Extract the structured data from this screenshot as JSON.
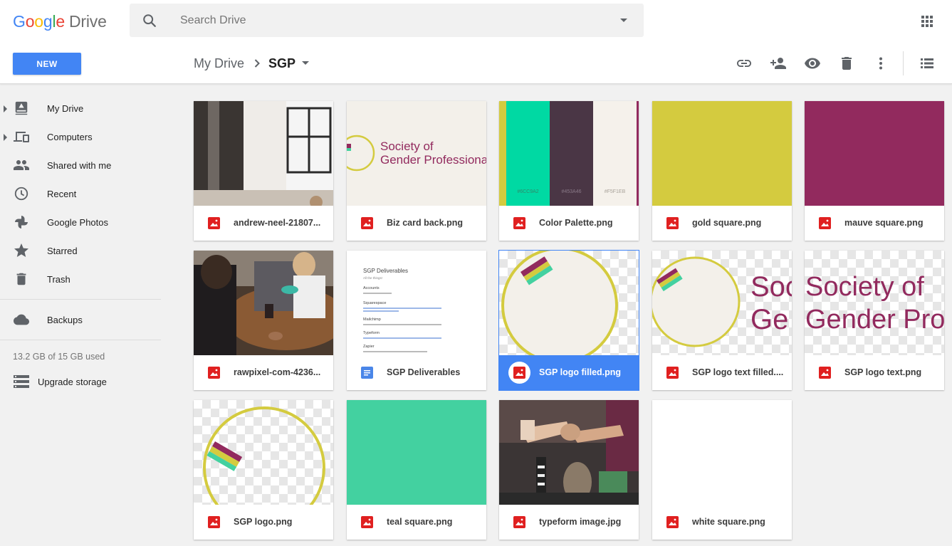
{
  "header": {
    "logo_letters": [
      "G",
      "o",
      "o",
      "g",
      "l",
      "e"
    ],
    "logo_product": "Drive",
    "search_placeholder": "Search Drive"
  },
  "toolbar": {
    "new_label": "NEW",
    "breadcrumb_root": "My Drive",
    "breadcrumb_current": "SGP",
    "actions": [
      "link-icon",
      "add-person-icon",
      "preview-eye-icon",
      "trash-icon",
      "more-vert-icon",
      "list-view-icon"
    ]
  },
  "sidebar": {
    "items": [
      {
        "label": "My Drive",
        "icon": "my-drive-icon",
        "expandable": true
      },
      {
        "label": "Computers",
        "icon": "computers-icon",
        "expandable": true
      },
      {
        "label": "Shared with me",
        "icon": "people-icon",
        "expandable": false
      },
      {
        "label": "Recent",
        "icon": "clock-icon",
        "expandable": false
      },
      {
        "label": "Google Photos",
        "icon": "pinwheel-icon",
        "expandable": false
      },
      {
        "label": "Starred",
        "icon": "star-icon",
        "expandable": false
      },
      {
        "label": "Trash",
        "icon": "trash-icon",
        "expandable": false
      }
    ],
    "backups_label": "Backups",
    "storage_text": "13.2 GB of 15 GB used",
    "upgrade_label": "Upgrade storage"
  },
  "files": [
    {
      "name": "andrew-neel-21807...",
      "type": "image",
      "thumb": "photo-office"
    },
    {
      "name": "Biz card back.png",
      "type": "image",
      "thumb": "biz-card",
      "thumb_text": [
        "Society of",
        "Gender Professionals"
      ]
    },
    {
      "name": "Color Palette.png",
      "type": "image",
      "thumb": "palette",
      "swatches": [
        {
          "hex": "#6CC9A2",
          "label": "#6CC9A2"
        },
        {
          "hex": "#453A46",
          "label": "#453A46"
        },
        {
          "hex": "#F5F1EB",
          "label": "#F5F1EB"
        }
      ]
    },
    {
      "name": "gold square.png",
      "type": "image",
      "thumb": "solid",
      "color": "#d4cb3f"
    },
    {
      "name": "mauve square.png",
      "type": "image",
      "thumb": "solid",
      "color": "#922a5e"
    },
    {
      "name": "rawpixel-com-4236...",
      "type": "image",
      "thumb": "photo-meeting"
    },
    {
      "name": "SGP Deliverables",
      "type": "doc",
      "thumb": "doc",
      "doc_title": "SGP Deliverables",
      "doc_subtitle": "All the things!",
      "doc_sections": [
        "Accounts",
        "Squarespace",
        "Mailchimp",
        "Typeform",
        "Zapier"
      ]
    },
    {
      "name": "SGP logo filled.png",
      "type": "image",
      "thumb": "logo-filled",
      "selected": true
    },
    {
      "name": "SGP logo text filled....",
      "type": "image",
      "thumb": "logo-text-filled",
      "thumb_text": [
        "Soc",
        "Ge"
      ]
    },
    {
      "name": "SGP logo text.png",
      "type": "image",
      "thumb": "logo-text",
      "thumb_text": [
        "Society of",
        "Gender Pro"
      ]
    },
    {
      "name": "SGP logo.png",
      "type": "image",
      "thumb": "logo"
    },
    {
      "name": "teal square.png",
      "type": "image",
      "thumb": "solid",
      "color": "#43d1a0"
    },
    {
      "name": "typeform image.jpg",
      "type": "image",
      "thumb": "photo-hands"
    },
    {
      "name": "white square.png",
      "type": "image",
      "thumb": "solid",
      "color": "#ffffff"
    }
  ],
  "colors": {
    "accent": "#4285f4",
    "mauve": "#922a5e",
    "gold": "#d4cb3f",
    "teal": "#43d1a0",
    "image_icon_red": "#e02020",
    "doc_icon_blue": "#4a86e8"
  }
}
